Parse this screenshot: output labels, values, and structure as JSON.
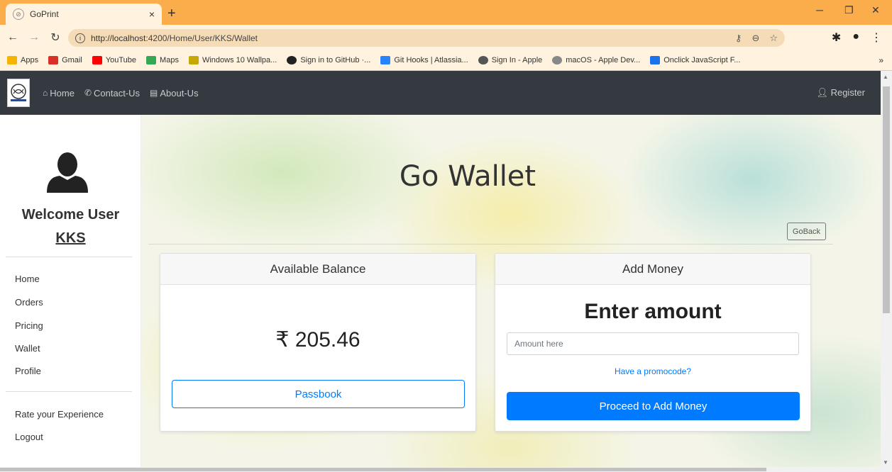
{
  "browser": {
    "tab_title": "GoPrint",
    "tab_close": "×",
    "new_tab": "+",
    "url_host": "http://localhost",
    "url_path": ":4200/Home/User/KKS/Wallet"
  },
  "bookmarks": [
    {
      "label": "Apps",
      "color": "#f4b400"
    },
    {
      "label": "Gmail",
      "color": "#d93025"
    },
    {
      "label": "YouTube",
      "color": "#ff0000"
    },
    {
      "label": "Maps",
      "color": "#34a853"
    },
    {
      "label": "Windows 10 Wallpa...",
      "color": "#c5a900"
    },
    {
      "label": "Sign in to GitHub ·...",
      "color": "#222222"
    },
    {
      "label": "Git Hooks | Atlassia...",
      "color": "#2684ff"
    },
    {
      "label": "Sign In - Apple",
      "color": "#555555"
    },
    {
      "label": "macOS - Apple Dev...",
      "color": "#888888"
    },
    {
      "label": "Onclick JavaScript F...",
      "color": "#1a73e8"
    }
  ],
  "bookmarks_more": "»",
  "nav": {
    "home": "Home",
    "contact": "Contact-Us",
    "about": "About-Us",
    "register": "Register"
  },
  "sidebar": {
    "welcome": "Welcome User",
    "username": "KKS",
    "items": [
      "Home",
      "Orders",
      "Pricing",
      "Wallet",
      "Profile"
    ],
    "bottom_items": [
      "Rate your Experience",
      "Logout"
    ]
  },
  "main": {
    "title": "Go Wallet",
    "goback": "GoBack",
    "balance_card": {
      "header": "Available Balance",
      "amount": "₹ 205.46",
      "passbook": "Passbook"
    },
    "add_card": {
      "header": "Add Money",
      "enter": "Enter amount",
      "placeholder": "Amount here",
      "promo": "Have a promocode?",
      "proceed": "Proceed to Add Money"
    }
  },
  "colors": {
    "accent": "#007bff",
    "navbar": "#343a40",
    "chrome": "#fbad4b"
  }
}
